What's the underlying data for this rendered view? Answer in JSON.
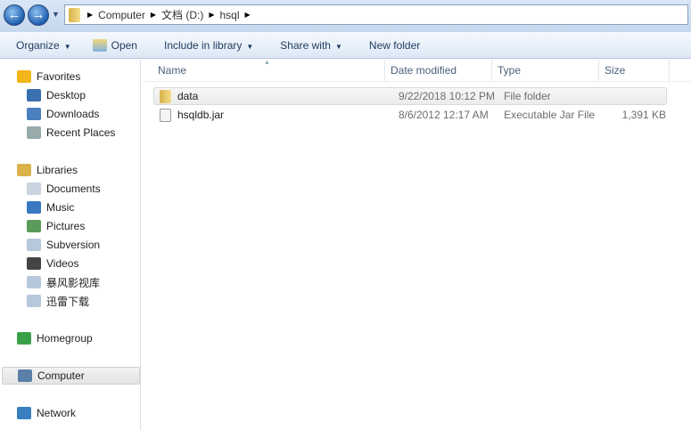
{
  "address": {
    "segments": [
      "Computer",
      "文档 (D:)",
      "hsql"
    ]
  },
  "toolbar": {
    "organize": "Organize",
    "open": "Open",
    "include": "Include in library",
    "share": "Share with",
    "new_folder": "New folder"
  },
  "sidebar": {
    "items": [
      {
        "label": "Favorites",
        "icon": "star-icon",
        "child": false
      },
      {
        "label": "Desktop",
        "icon": "desktop-icon",
        "child": true
      },
      {
        "label": "Downloads",
        "icon": "downloads-icon",
        "child": true
      },
      {
        "label": "Recent Places",
        "icon": "recent-places-icon",
        "child": true
      },
      {
        "label": "Libraries",
        "icon": "libraries-icon",
        "child": false
      },
      {
        "label": "Documents",
        "icon": "documents-icon",
        "child": true
      },
      {
        "label": "Music",
        "icon": "music-icon",
        "child": true
      },
      {
        "label": "Pictures",
        "icon": "pictures-icon",
        "child": true
      },
      {
        "label": "Subversion",
        "icon": "library-icon",
        "child": true
      },
      {
        "label": "Videos",
        "icon": "videos-icon",
        "child": true
      },
      {
        "label": "暴风影视库",
        "icon": "library-icon",
        "child": true
      },
      {
        "label": "迅雷下载",
        "icon": "library-icon",
        "child": true
      },
      {
        "label": "Homegroup",
        "icon": "homegroup-icon",
        "child": false
      },
      {
        "label": "Computer",
        "icon": "computer-icon",
        "child": false,
        "selected": true
      },
      {
        "label": "Network",
        "icon": "network-icon",
        "child": false
      }
    ]
  },
  "columns": [
    "Name",
    "Date modified",
    "Type",
    "Size"
  ],
  "files": [
    {
      "name": "data",
      "date": "9/22/2018 10:12 PM",
      "type": "File folder",
      "size": "",
      "icon": "folder-icon"
    },
    {
      "name": "hsqldb.jar",
      "date": "8/6/2012 12:17 AM",
      "type": "Executable Jar File",
      "size": "1,391 KB",
      "icon": "jar-file-icon"
    }
  ]
}
